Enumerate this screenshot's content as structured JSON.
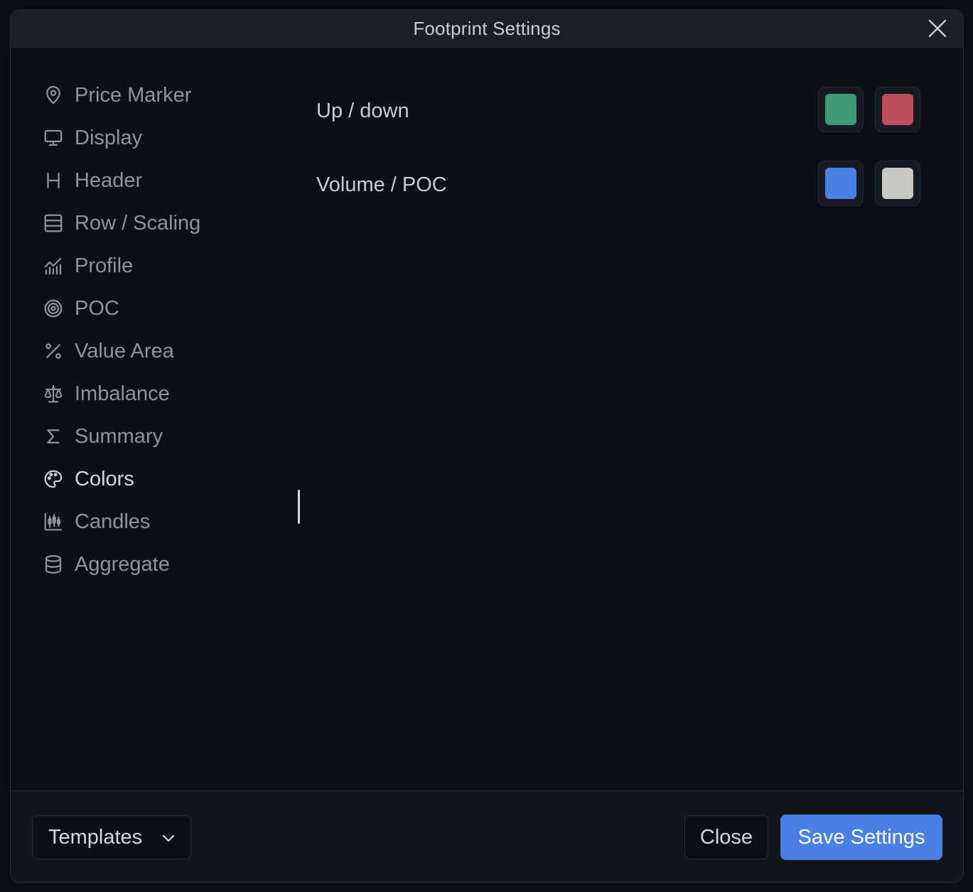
{
  "window": {
    "title": "Footprint Settings"
  },
  "sidebar": {
    "items": [
      {
        "label": "Price Marker",
        "icon": "map-pin-icon"
      },
      {
        "label": "Display",
        "icon": "monitor-icon"
      },
      {
        "label": "Header",
        "icon": "heading-icon"
      },
      {
        "label": "Row / Scaling",
        "icon": "rows-icon"
      },
      {
        "label": "Profile",
        "icon": "chart-histogram-icon"
      },
      {
        "label": "POC",
        "icon": "target-icon"
      },
      {
        "label": "Value Area",
        "icon": "percent-icon"
      },
      {
        "label": "Imbalance",
        "icon": "scale-icon"
      },
      {
        "label": "Summary",
        "icon": "sigma-icon"
      },
      {
        "label": "Colors",
        "icon": "palette-icon",
        "active": true
      },
      {
        "label": "Candles",
        "icon": "candlestick-icon"
      },
      {
        "label": "Aggregate",
        "icon": "database-icon"
      }
    ]
  },
  "colors": {
    "rows": [
      {
        "label": "Up / down",
        "swatches": [
          "#3f9b76",
          "#c04f5c"
        ]
      },
      {
        "label": "Volume / POC",
        "swatches": [
          "#4a7fe6",
          "#c9c7c2"
        ]
      }
    ]
  },
  "footer": {
    "templates_label": "Templates",
    "close_label": "Close",
    "save_label": "Save Settings"
  },
  "theme": {
    "accent": "#4a7fe6",
    "background": "#0b0f16"
  }
}
